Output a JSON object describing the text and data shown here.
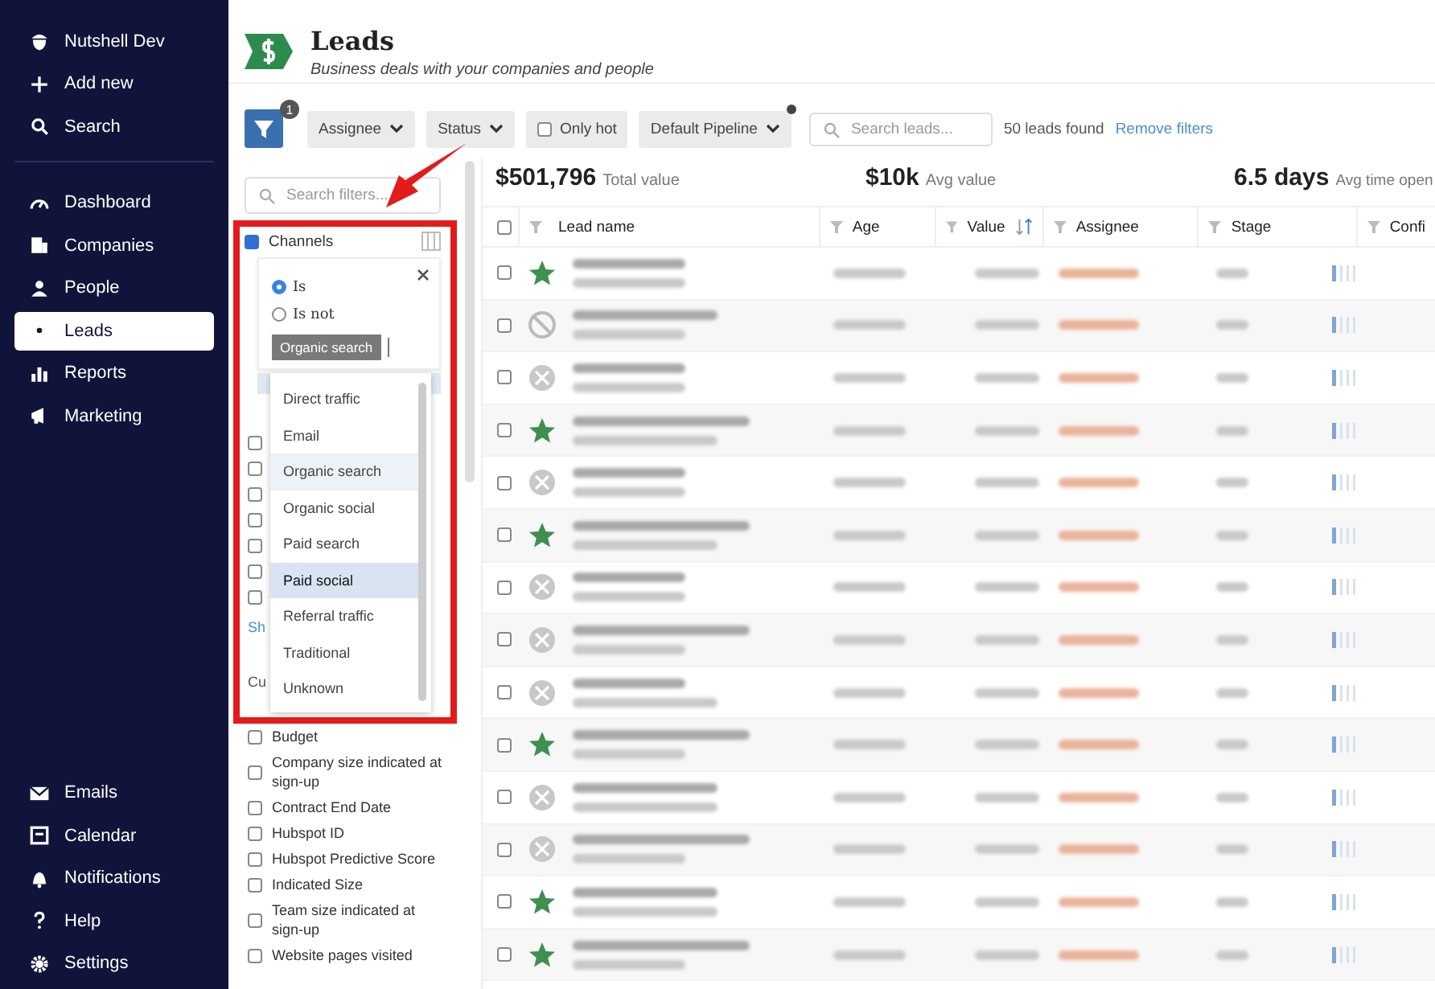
{
  "sidebar": {
    "account": "Nutshell Dev",
    "top_items": [
      {
        "label": "Add new",
        "selected": false
      },
      {
        "label": "Search",
        "selected": false
      }
    ],
    "items": [
      {
        "label": "Dashboard",
        "selected": false
      },
      {
        "label": "Companies",
        "selected": false
      },
      {
        "label": "People",
        "selected": false
      },
      {
        "label": "Leads",
        "selected": true
      },
      {
        "label": "Reports",
        "selected": false
      },
      {
        "label": "Marketing",
        "selected": false
      }
    ],
    "bottom_items": [
      {
        "label": "Emails",
        "selected": false
      },
      {
        "label": "Calendar",
        "selected": false
      },
      {
        "label": "Notifications",
        "selected": false
      },
      {
        "label": "Help",
        "selected": false
      },
      {
        "label": "Settings",
        "selected": false
      }
    ]
  },
  "header": {
    "title": "Leads",
    "subtitle": "Business deals with your companies and people"
  },
  "toolbar": {
    "filter_badge": "1",
    "dropdowns": [
      "Assignee",
      "Status"
    ],
    "only_hot": {
      "label": "Only hot",
      "checked": false
    },
    "pipeline": {
      "label": "Default Pipeline",
      "modified": true
    },
    "search": {
      "placeholder": "Search leads..."
    },
    "count": "50 leads found",
    "clear_link": "Remove filters"
  },
  "filters": {
    "search": {
      "placeholder": "Search filters..."
    },
    "channels": {
      "label": "Channels",
      "checked": true,
      "operators": [
        {
          "label": "Is",
          "selected": true
        },
        {
          "label": "Is not",
          "selected": false
        }
      ],
      "tag": "Organic search",
      "options": [
        {
          "label": "Direct traffic",
          "selected": false,
          "hovered": false
        },
        {
          "label": "Email",
          "selected": false,
          "hovered": false
        },
        {
          "label": "Organic search",
          "selected": true,
          "hovered": false
        },
        {
          "label": "Organic social",
          "selected": false,
          "hovered": false
        },
        {
          "label": "Paid search",
          "selected": false,
          "hovered": false
        },
        {
          "label": "Paid social",
          "selected": false,
          "hovered": true
        },
        {
          "label": "Referral traffic",
          "selected": false,
          "hovered": false
        },
        {
          "label": "Traditional",
          "selected": false,
          "hovered": false
        },
        {
          "label": "Unknown",
          "selected": false,
          "hovered": false
        }
      ]
    },
    "covered_checkboxes": [
      {
        "checked": false
      },
      {
        "checked": false
      },
      {
        "checked": false
      },
      {
        "checked": false
      },
      {
        "checked": false
      },
      {
        "checked": false
      },
      {
        "checked": false
      }
    ],
    "show_link": "Sh",
    "section_label": "Cu",
    "fields": [
      {
        "label": "Budget",
        "checked": false
      },
      {
        "label": "Company size indicated at sign-up",
        "checked": false
      },
      {
        "label": "Contract End Date",
        "checked": false
      },
      {
        "label": "Hubspot ID",
        "checked": false
      },
      {
        "label": "Hubspot Predictive Score",
        "checked": false
      },
      {
        "label": "Indicated Size",
        "checked": false
      },
      {
        "label": "Team size indicated at sign-up",
        "checked": false
      },
      {
        "label": "Website pages visited",
        "checked": false
      }
    ]
  },
  "stats": [
    {
      "value": "$501,796",
      "label": "Total value"
    },
    {
      "value": "$10k",
      "label": "Avg value"
    },
    {
      "value": "6.5 days",
      "label": "Avg time open"
    }
  ],
  "table": {
    "columns": [
      {
        "label": "Lead name",
        "sorted": false
      },
      {
        "label": "Age",
        "sorted": false
      },
      {
        "label": "Value",
        "sorted": true
      },
      {
        "label": "Assignee",
        "sorted": false
      },
      {
        "label": "Stage",
        "sorted": false
      },
      {
        "label": "Confi",
        "sorted": false
      }
    ],
    "select_all": false,
    "rows": [
      {
        "kind": "hot",
        "checked": false
      },
      {
        "kind": "cancelled",
        "checked": false
      },
      {
        "kind": "lost",
        "checked": false
      },
      {
        "kind": "hot",
        "checked": false
      },
      {
        "kind": "lost",
        "checked": false
      },
      {
        "kind": "hot",
        "checked": false
      },
      {
        "kind": "lost",
        "checked": false
      },
      {
        "kind": "lost",
        "checked": false
      },
      {
        "kind": "lost",
        "checked": false
      },
      {
        "kind": "hot",
        "checked": false
      },
      {
        "kind": "lost",
        "checked": false
      },
      {
        "kind": "lost",
        "checked": false
      },
      {
        "kind": "hot",
        "checked": false
      },
      {
        "kind": "hot",
        "checked": false
      }
    ]
  }
}
